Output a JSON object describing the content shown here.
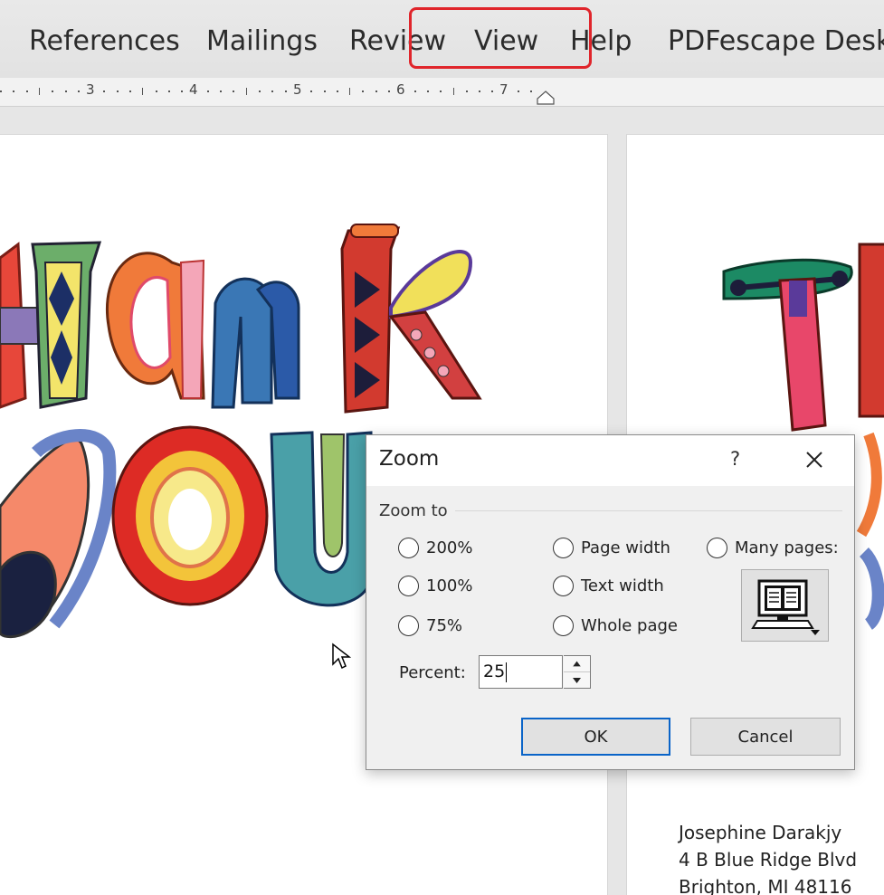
{
  "ribbon": {
    "tabs": [
      {
        "label": "References"
      },
      {
        "label": "Mailings"
      },
      {
        "label": "Review"
      },
      {
        "label": "View"
      },
      {
        "label": "Help"
      },
      {
        "label": "PDFescape Desktop"
      }
    ]
  },
  "ruler": {
    "numbers": [
      "3",
      "4",
      "5",
      "6",
      "7"
    ]
  },
  "address": {
    "line1": "Josephine Darakjy",
    "line2": "4 B Blue Ridge Blvd",
    "line3": "Brighton, MI 48116"
  },
  "dialog": {
    "title": "Zoom",
    "help": "?",
    "group_label": "Zoom to",
    "options": {
      "z200": "200%",
      "z100": "100%",
      "z75": "75%",
      "page_width": "Page width",
      "text_width": "Text width",
      "whole_page": "Whole page",
      "many_pages": "Many pages:"
    },
    "percent_label": "Percent:",
    "percent_value": "25",
    "ok_label": "OK",
    "cancel_label": "Cancel"
  },
  "colors": {
    "highlight": "#e0252b",
    "ok_border": "#0a64c8"
  },
  "icons": [
    "close-icon",
    "spin-up-icon",
    "spin-down-icon",
    "many-pages-monitor-icon",
    "mouse-pointer-icon",
    "indent-marker-icon"
  ]
}
